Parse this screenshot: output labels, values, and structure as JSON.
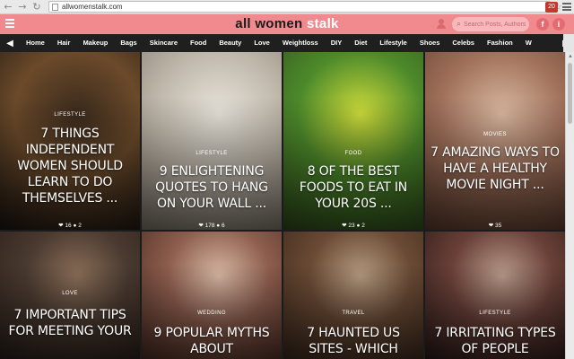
{
  "browser": {
    "url": "allwomenstalk.com",
    "extension_badge": "20"
  },
  "header": {
    "logo_part1": "all women ",
    "logo_part2": "stalk",
    "search_placeholder": "Search Posts, Authors, etc",
    "fb_label": "f",
    "info_label": "i"
  },
  "nav": {
    "prev_arrow": "◀",
    "next_arrow": "▶",
    "items": [
      "Home",
      "Hair",
      "Makeup",
      "Bags",
      "Skincare",
      "Food",
      "Beauty",
      "Love",
      "Weightloss",
      "DIY",
      "Diet",
      "Lifestyle",
      "Shoes",
      "Celebs",
      "Fashion",
      "W"
    ]
  },
  "tiles": [
    {
      "category": "Lifestyle",
      "title": "7 Things Independent Women Should Learn to Do Themselves ...",
      "likes": "16",
      "comments": "2",
      "colors": [
        "#3a2a1c",
        "#6b4a2a",
        "#1a1410"
      ]
    },
    {
      "category": "Lifestyle",
      "title": "9 Enlightening Quotes to Hang on Your Wall ...",
      "likes": "178",
      "comments": "6",
      "colors": [
        "#e8e4dc",
        "#bfb7aa",
        "#7c7468"
      ]
    },
    {
      "category": "Food",
      "title": "8 of the Best Foods to Eat in Your 20s ...",
      "likes": "23",
      "comments": "2",
      "colors": [
        "#cfdc3a",
        "#4d8a2b",
        "#2f4a1b"
      ]
    },
    {
      "category": "Movies",
      "title": "7 Amazing Ways to Have a Healthy Movie Night ...",
      "likes": "35",
      "comments": "",
      "colors": [
        "#d9b8a0",
        "#a0705a",
        "#5a3a2a"
      ]
    },
    {
      "category": "Love",
      "title": "7 Important Tips for Meeting Your",
      "likes": "",
      "comments": "",
      "colors": [
        "#8a6e58",
        "#4a3a30",
        "#2a201a"
      ]
    },
    {
      "category": "Wedding",
      "title": "9 Popular Myths About",
      "likes": "",
      "comments": "",
      "colors": [
        "#d7b7a4",
        "#8e5e4e",
        "#4a2c22"
      ]
    },
    {
      "category": "Travel",
      "title": "7 Haunted US Sites - Which",
      "likes": "",
      "comments": "",
      "colors": [
        "#b59a80",
        "#6a4a34",
        "#3a281c"
      ]
    },
    {
      "category": "Lifestyle",
      "title": "7 Irritating Types of People",
      "likes": "",
      "comments": "",
      "colors": [
        "#b89a8a",
        "#6a4038",
        "#2a1a18"
      ]
    }
  ]
}
